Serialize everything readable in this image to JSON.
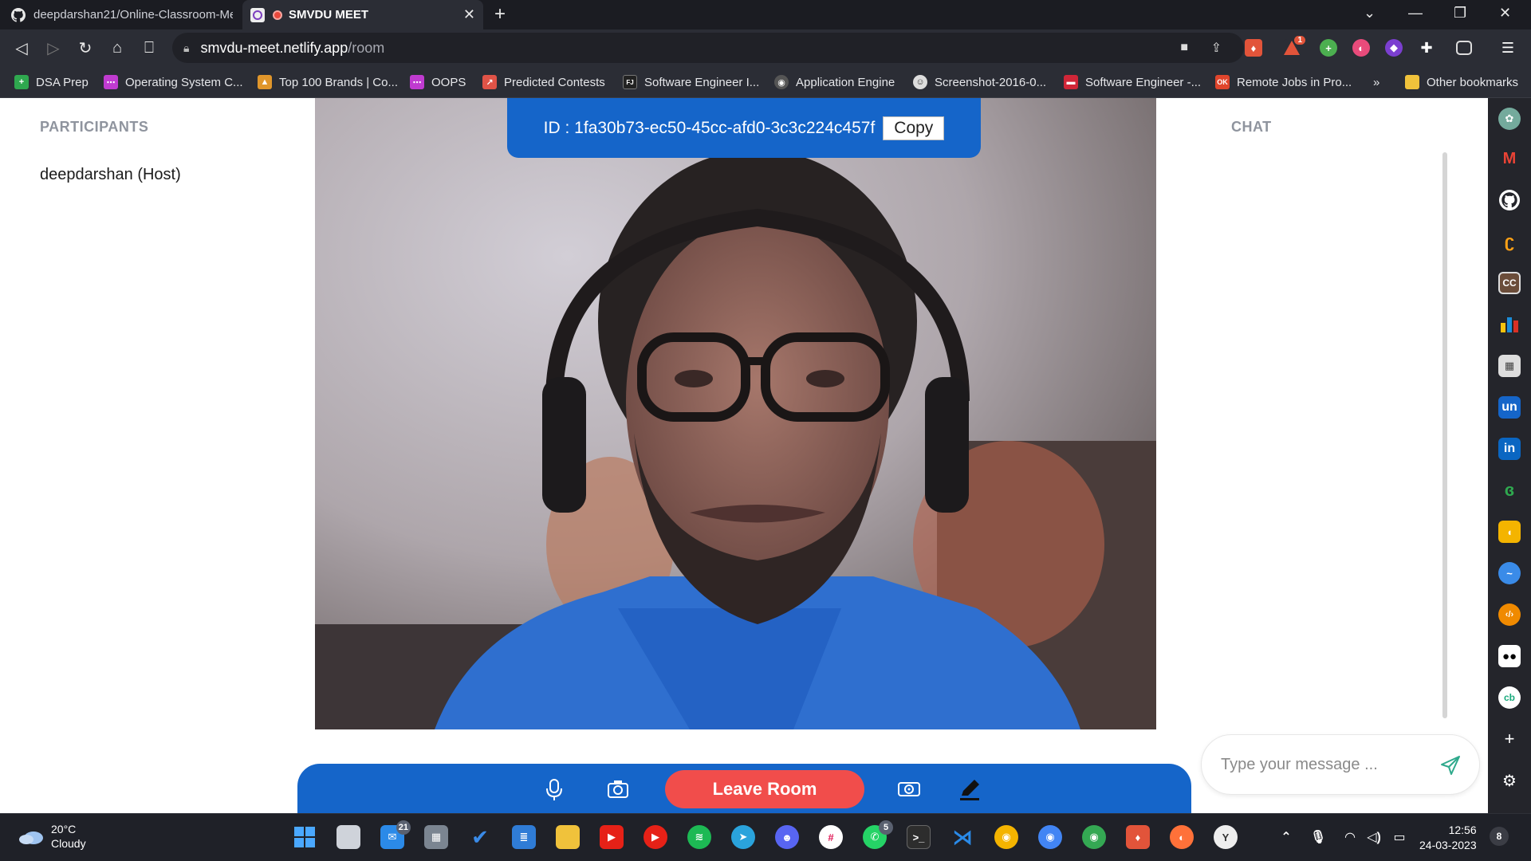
{
  "browser": {
    "tabs": [
      {
        "label": "deepdarshan21/Online-Classroom-Me",
        "icon": "github-icon"
      },
      {
        "label": "SMVDU MEET",
        "icon": "app-icon",
        "active": true
      }
    ],
    "url_host": "smvdu-meet.netlify.app",
    "url_path": "/room",
    "bookmarks": [
      {
        "label": "DSA Prep",
        "color": "#2fa84f",
        "glyph": "+"
      },
      {
        "label": "Operating System C...",
        "color": "#c03bd0",
        "glyph": "⋯"
      },
      {
        "label": "Top 100 Brands | Co...",
        "color": "#e0962b",
        "glyph": "▲"
      },
      {
        "label": "OOPS",
        "color": "#c03bd0",
        "glyph": "⋯"
      },
      {
        "label": "Predicted Contests",
        "color": "#e05347",
        "glyph": "↗"
      },
      {
        "label": "Software Engineer I...",
        "color": "#222",
        "glyph": "FJ"
      },
      {
        "label": "Application Engine",
        "color": "#555",
        "glyph": "◉"
      },
      {
        "label": "Screenshot-2016-0...",
        "color": "#ddd",
        "glyph": "☺"
      },
      {
        "label": "Software Engineer -...",
        "color": "#d02638",
        "glyph": "▬"
      },
      {
        "label": "Remote Jobs in Pro...",
        "color": "#e0452c",
        "glyph": "OK"
      }
    ],
    "bookmarks_more": "»",
    "other_bookmarks": "Other bookmarks",
    "extension_badge": "1"
  },
  "room": {
    "participants_title": "PARTICIPANTS",
    "participants": [
      "deepdarshan (Host)"
    ],
    "chat_title": "CHAT",
    "room_id": "ID : 1fa30b73-ec50-45cc-afd0-3c3c224c457f",
    "copy_label": "Copy",
    "leave_label": "Leave Room",
    "message_placeholder": "Type your message ...",
    "accent_color": "#1565c9",
    "leave_color": "#f14d4b"
  },
  "taskbar": {
    "temperature": "20°C",
    "weather": "Cloudy",
    "mail_badge": "21",
    "whatsapp_badge": "5",
    "time": "12:56",
    "date": "24-03-2023",
    "notification_count": "8"
  }
}
